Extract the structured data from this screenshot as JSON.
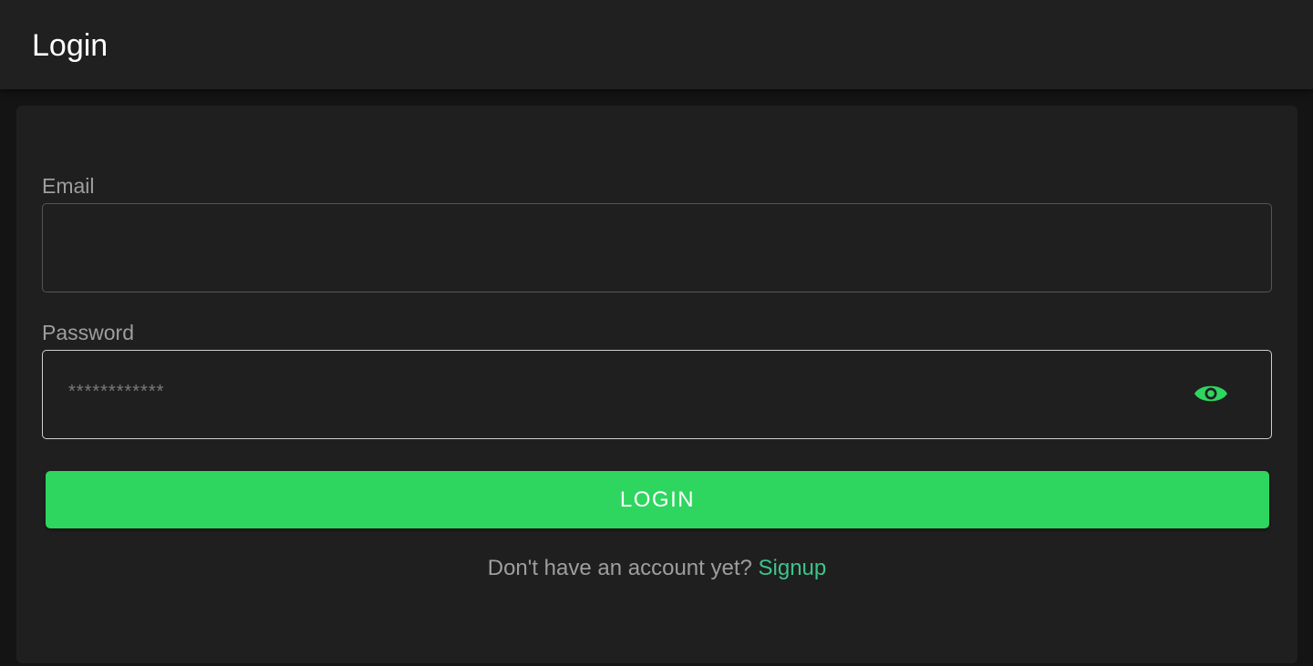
{
  "header": {
    "title": "Login"
  },
  "form": {
    "email": {
      "label": "Email",
      "value": "",
      "placeholder": ""
    },
    "password": {
      "label": "Password",
      "value": "",
      "placeholder": "************",
      "toggle_icon": "eye-icon"
    },
    "submit_label": "LOGIN",
    "signup_prompt": "Don't have an account yet?",
    "signup_link": "Signup"
  },
  "colors": {
    "background": "#141414",
    "surface": "#1f1f1f",
    "accent": "#2ed65f",
    "link": "#3cc48a",
    "label": "#9e9e9e"
  }
}
